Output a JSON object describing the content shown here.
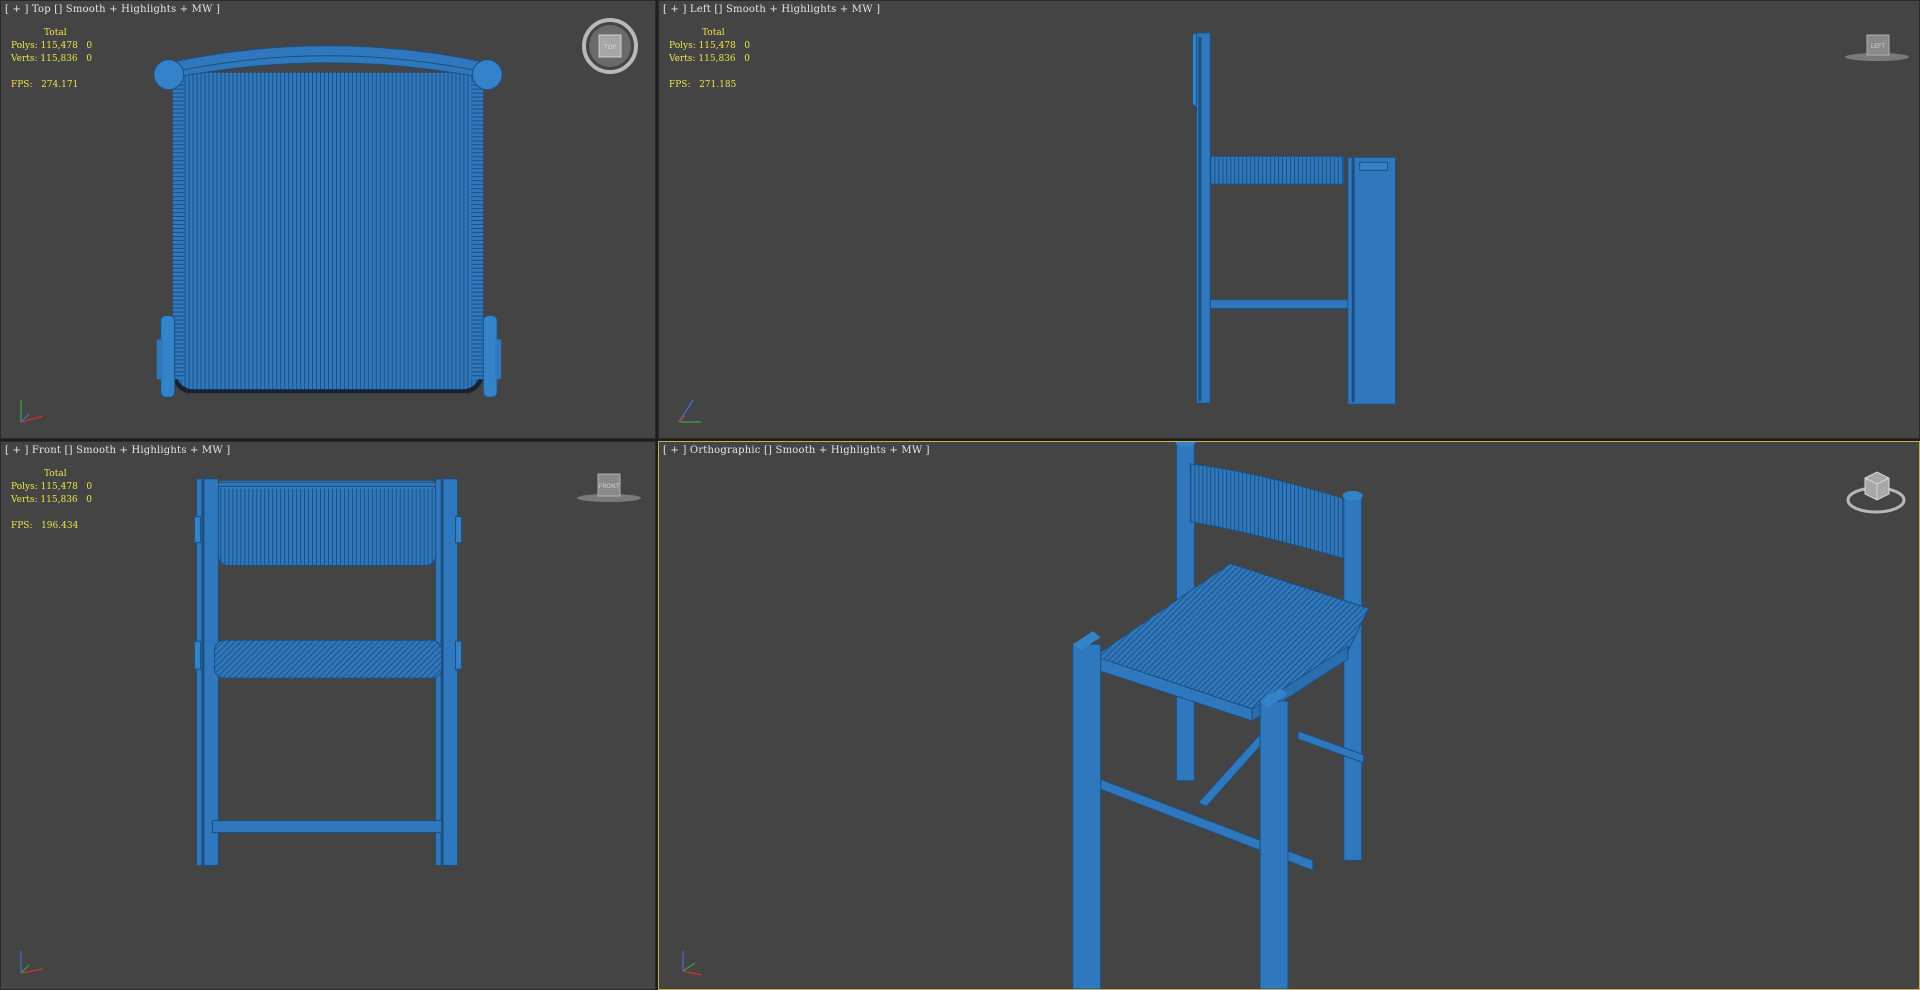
{
  "viewports": {
    "top": {
      "label": "[ + ] Top [] Smooth + Highlights + MW ]",
      "stats": {
        "header": "Total",
        "polys": "Polys: 115,478   0",
        "verts": "Verts: 115,836   0",
        "fps": "FPS:   274.171"
      },
      "navcube": "TOP"
    },
    "left": {
      "label": "[ + ] Left [] Smooth + Highlights + MW ]",
      "stats": {
        "header": "Total",
        "polys": "Polys: 115,478   0",
        "verts": "Verts: 115,836   0",
        "fps": "FPS:   271.185"
      },
      "navcube": "LEFT"
    },
    "front": {
      "label": "[ + ] Front [] Smooth + Highlights + MW ]",
      "stats": {
        "header": "Total",
        "polys": "Polys: 115,478   0",
        "verts": "Verts: 115,836   0",
        "fps": "FPS:   196.434"
      },
      "navcube": "FRONT"
    },
    "perspective": {
      "label": "[ + ] Orthographic [] Smooth + Highlights + MW ]"
    }
  },
  "colors": {
    "viewport_bg": "#444444",
    "model_blue": "#2f78bd",
    "stats_text": "#f0e24a",
    "active_border": "#c9b04a"
  },
  "icons": [
    "navcube-icon",
    "axis-triad-icon"
  ]
}
